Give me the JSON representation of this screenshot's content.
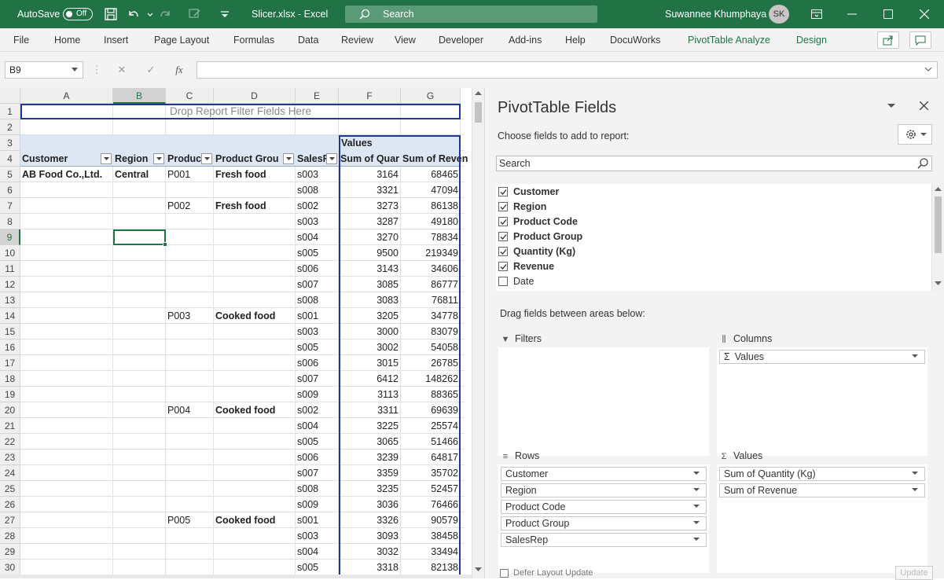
{
  "titlebar": {
    "autosave_label": "AutoSave",
    "autosave_state": "Off",
    "filename": "Slicer.xlsx - Excel",
    "search_placeholder": "Search",
    "user_name": "Suwannee Khumphaya",
    "user_initials": "SK",
    "bg_color": "#217346"
  },
  "ribbon": {
    "tabs": [
      "File",
      "Home",
      "Insert",
      "Page Layout",
      "Formulas",
      "Data",
      "Review",
      "View",
      "Developer",
      "Add-ins",
      "Help",
      "DocuWorks",
      "PivotTable Analyze",
      "Design"
    ]
  },
  "formula_bar": {
    "name_box": "B9",
    "fx_label": "fx",
    "formula": ""
  },
  "sheet": {
    "columns": [
      "A",
      "B",
      "C",
      "D",
      "E",
      "F",
      "G"
    ],
    "selected_column": "B",
    "rows": [
      "1",
      "2",
      "3",
      "4",
      "5",
      "6",
      "7",
      "8",
      "9",
      "10",
      "11",
      "12",
      "13",
      "14",
      "15",
      "16",
      "17",
      "18",
      "19",
      "20",
      "21",
      "22",
      "23",
      "24",
      "25",
      "26",
      "27",
      "28",
      "29",
      "30"
    ],
    "selected_row": "9",
    "filter_zone": "Drop Report Filter Fields Here",
    "values_label": "Values",
    "headers": [
      "Customer",
      "Region",
      "Product Code",
      "Product Group",
      "SalesRep",
      "Sum of Quantity (Kg)",
      "Sum of Revenue"
    ],
    "header_display": [
      "Customer",
      "Region",
      "Produc",
      "Product Grou",
      "SalesR",
      "Sum of Quar",
      "Sum of Reven"
    ],
    "data_rows": [
      {
        "customer": "AB Food Co.,Ltd.",
        "region": "Central",
        "code": "P001",
        "group": "Fresh food",
        "rep": "s003",
        "qty": "3164",
        "rev": "68465"
      },
      {
        "customer": "",
        "region": "",
        "code": "",
        "group": "",
        "rep": "s008",
        "qty": "3321",
        "rev": "47094"
      },
      {
        "customer": "",
        "region": "",
        "code": "P002",
        "group": "Fresh food",
        "rep": "s002",
        "qty": "3273",
        "rev": "86138"
      },
      {
        "customer": "",
        "region": "",
        "code": "",
        "group": "",
        "rep": "s003",
        "qty": "3287",
        "rev": "49180"
      },
      {
        "customer": "",
        "region": "",
        "code": "",
        "group": "",
        "rep": "s004",
        "qty": "3270",
        "rev": "78834"
      },
      {
        "customer": "",
        "region": "",
        "code": "",
        "group": "",
        "rep": "s005",
        "qty": "9500",
        "rev": "219349"
      },
      {
        "customer": "",
        "region": "",
        "code": "",
        "group": "",
        "rep": "s006",
        "qty": "3143",
        "rev": "34606"
      },
      {
        "customer": "",
        "region": "",
        "code": "",
        "group": "",
        "rep": "s007",
        "qty": "3085",
        "rev": "86777"
      },
      {
        "customer": "",
        "region": "",
        "code": "",
        "group": "",
        "rep": "s008",
        "qty": "3083",
        "rev": "76811"
      },
      {
        "customer": "",
        "region": "",
        "code": "P003",
        "group": "Cooked food",
        "rep": "s001",
        "qty": "3205",
        "rev": "34778"
      },
      {
        "customer": "",
        "region": "",
        "code": "",
        "group": "",
        "rep": "s003",
        "qty": "3000",
        "rev": "83079"
      },
      {
        "customer": "",
        "region": "",
        "code": "",
        "group": "",
        "rep": "s005",
        "qty": "3002",
        "rev": "54058"
      },
      {
        "customer": "",
        "region": "",
        "code": "",
        "group": "",
        "rep": "s006",
        "qty": "3015",
        "rev": "26785"
      },
      {
        "customer": "",
        "region": "",
        "code": "",
        "group": "",
        "rep": "s007",
        "qty": "6412",
        "rev": "148262"
      },
      {
        "customer": "",
        "region": "",
        "code": "",
        "group": "",
        "rep": "s009",
        "qty": "3113",
        "rev": "88365"
      },
      {
        "customer": "",
        "region": "",
        "code": "P004",
        "group": "Cooked food",
        "rep": "s002",
        "qty": "3311",
        "rev": "69639"
      },
      {
        "customer": "",
        "region": "",
        "code": "",
        "group": "",
        "rep": "s004",
        "qty": "3225",
        "rev": "25574"
      },
      {
        "customer": "",
        "region": "",
        "code": "",
        "group": "",
        "rep": "s005",
        "qty": "3065",
        "rev": "51466"
      },
      {
        "customer": "",
        "region": "",
        "code": "",
        "group": "",
        "rep": "s006",
        "qty": "3239",
        "rev": "64817"
      },
      {
        "customer": "",
        "region": "",
        "code": "",
        "group": "",
        "rep": "s007",
        "qty": "3359",
        "rev": "35702"
      },
      {
        "customer": "",
        "region": "",
        "code": "",
        "group": "",
        "rep": "s008",
        "qty": "3235",
        "rev": "52457"
      },
      {
        "customer": "",
        "region": "",
        "code": "",
        "group": "",
        "rep": "s009",
        "qty": "3036",
        "rev": "76466"
      },
      {
        "customer": "",
        "region": "",
        "code": "P005",
        "group": "Cooked food",
        "rep": "s001",
        "qty": "3326",
        "rev": "90579"
      },
      {
        "customer": "",
        "region": "",
        "code": "",
        "group": "",
        "rep": "s003",
        "qty": "3093",
        "rev": "38458"
      },
      {
        "customer": "",
        "region": "",
        "code": "",
        "group": "",
        "rep": "s004",
        "qty": "3032",
        "rev": "33494"
      },
      {
        "customer": "",
        "region": "",
        "code": "",
        "group": "",
        "rep": "s005",
        "qty": "3318",
        "rev": "82138"
      }
    ]
  },
  "pivot_pane": {
    "title": "PivotTable Fields",
    "subtitle": "Choose fields to add to report:",
    "search_placeholder": "Search",
    "fields": [
      {
        "name": "Customer",
        "checked": true
      },
      {
        "name": "Region",
        "checked": true
      },
      {
        "name": "Product Code",
        "checked": true
      },
      {
        "name": "Product Group",
        "checked": true
      },
      {
        "name": "Quantity (Kg)",
        "checked": true
      },
      {
        "name": "Revenue",
        "checked": true
      },
      {
        "name": "Date",
        "checked": false
      }
    ],
    "drag_label": "Drag fields between areas below:",
    "areas": {
      "filters": {
        "label": "Filters",
        "items": []
      },
      "columns": {
        "label": "Columns",
        "items": [
          "Values"
        ]
      },
      "rows": {
        "label": "Rows",
        "items": [
          "Customer",
          "Region",
          "Product Code",
          "Product Group",
          "SalesRep"
        ]
      },
      "values": {
        "label": "Values",
        "items": [
          "Sum of Quantity (Kg)",
          "Sum of Revenue"
        ]
      }
    },
    "footer_partial": "Defer Layout Update",
    "update_label": "Update"
  }
}
